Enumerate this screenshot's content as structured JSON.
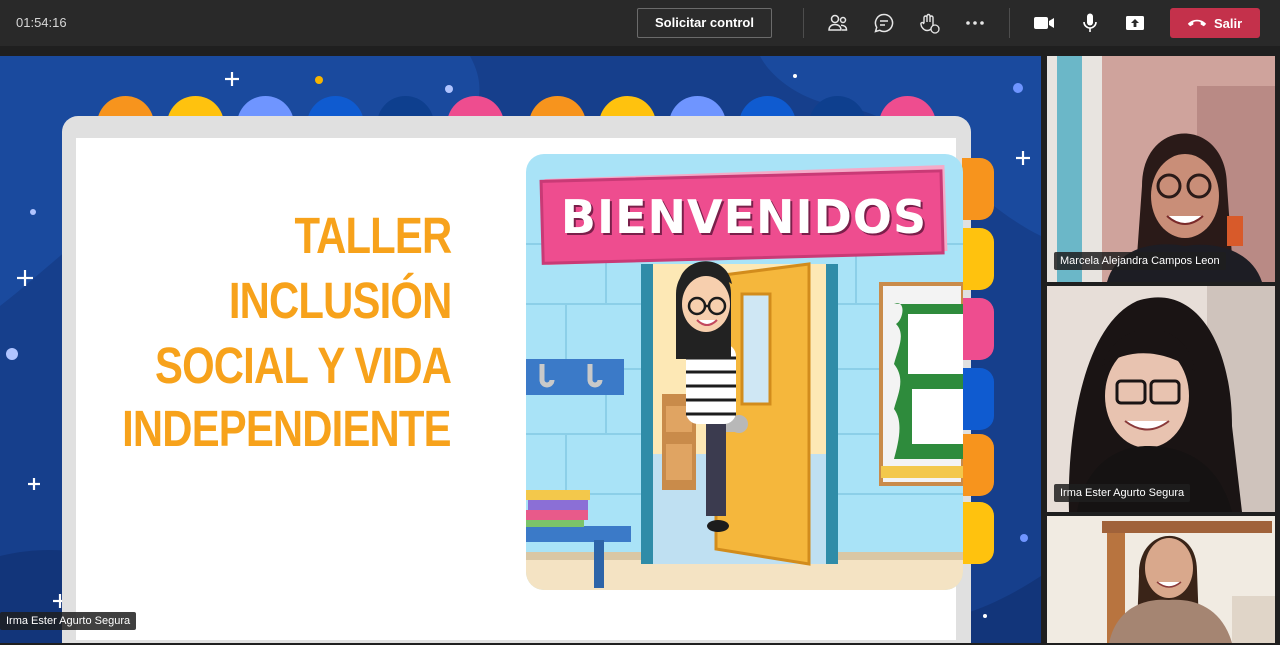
{
  "toolbar": {
    "timer": "01:54:16",
    "request_control_label": "Solicitar control",
    "leave_label": "Salir",
    "icons": [
      "participants-icon",
      "chat-icon",
      "reactions-icon",
      "more-icon",
      "camera-icon",
      "mic-icon",
      "share-icon",
      "phone-icon"
    ]
  },
  "slide": {
    "title_lines": [
      "TALLER",
      "INCLUSIÓN",
      "SOCIAL Y VIDA",
      "INDEPENDIENTE"
    ],
    "banner": "BIENVENIDOS",
    "colors": {
      "background": "#163f8c",
      "title": "#f7a21b",
      "banner": "#ee4d8f"
    }
  },
  "presenter": {
    "name": "Irma Ester Agurto Segura"
  },
  "participants": [
    {
      "name": "Marcela Alejandra Campos Leon"
    },
    {
      "name": "Irma Ester Agurto Segura"
    },
    {
      "name": ""
    }
  ]
}
